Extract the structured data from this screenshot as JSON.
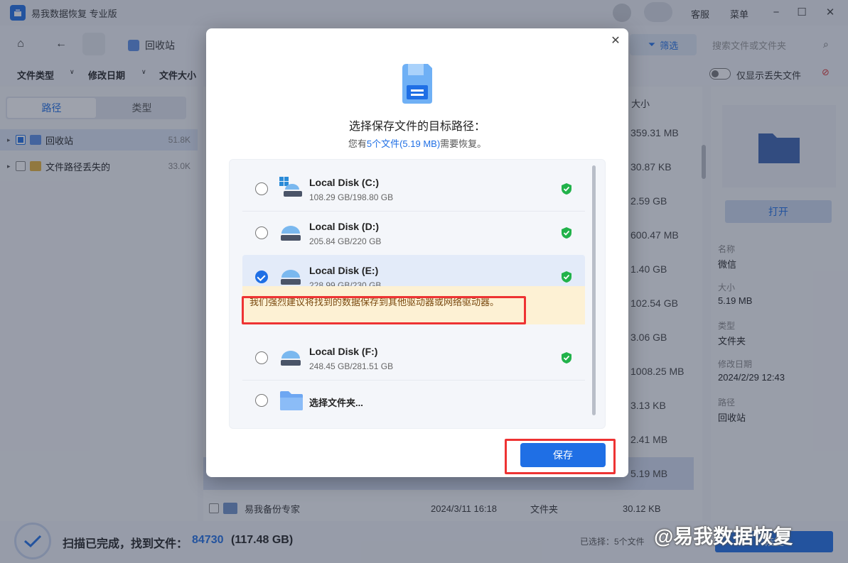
{
  "app": {
    "title": "易我数据恢复 专业版"
  },
  "titlebar": {
    "service": "客服",
    "menu": "菜单"
  },
  "toolbar": {
    "breadcrumb": "回收站",
    "filter_label": "筛选",
    "search_placeholder": "搜索文件或文件夹"
  },
  "filters": {
    "file_type": "文件类型",
    "modified_date": "修改日期",
    "file_size": "文件大小",
    "only_lost": "仅显示丢失文件"
  },
  "sidebar": {
    "tabs": [
      "路径",
      "类型"
    ],
    "items": [
      {
        "label": "回收站",
        "size": "51.8K"
      },
      {
        "label": "文件路径丢失的",
        "size": "33.0K"
      }
    ]
  },
  "list": {
    "size_header": "大小",
    "sizes": [
      "359.31 MB",
      "30.87 KB",
      "2.59 GB",
      "600.47 MB",
      "1.40 GB",
      "102.54 GB",
      "3.06 GB",
      "1008.25 MB",
      "3.13 KB",
      "2.41 MB",
      "5.19 MB",
      "30.12 KB"
    ],
    "last_row": {
      "name": "易我备份专家",
      "date": "2024/3/11 16:18",
      "type": "文件夹",
      "size": "30.12 KB"
    }
  },
  "details": {
    "open_label": "打开",
    "fields": [
      {
        "label": "名称",
        "value": "微信"
      },
      {
        "label": "大小",
        "value": "5.19 MB"
      },
      {
        "label": "类型",
        "value": "文件夹"
      },
      {
        "label": "修改日期",
        "value": "2024/2/29 12:43"
      },
      {
        "label": "路径",
        "value": "回收站"
      }
    ]
  },
  "status": {
    "text": "扫描已完成，找到文件：",
    "count": "84730",
    "size": "(117.48 GB)",
    "selected": "已选择：5个文件",
    "recover_label": "恢复"
  },
  "watermark": "@易我数据恢复",
  "dialog": {
    "title": "选择保存文件的目标路径：",
    "subtitle_prefix": "您有",
    "subtitle_highlight": "5个文件(5.19 MB)",
    "subtitle_suffix": "需要恢复。",
    "disks": [
      {
        "name": "Local Disk (C:)",
        "capacity": "108.29 GB/198.80 GB",
        "selected": false
      },
      {
        "name": "Local Disk (D:)",
        "capacity": "205.84 GB/220 GB",
        "selected": false
      },
      {
        "name": "Local Disk (E:)",
        "capacity": "228.99 GB/230 GB",
        "selected": true
      },
      {
        "name": "Local Disk (F:)",
        "capacity": "248.45 GB/281.51 GB",
        "selected": false
      }
    ],
    "warning": "我们强烈建议将找到的数据保存到其他驱动器或网络驱动器。",
    "choose_folder": "选择文件夹...",
    "save_label": "保存"
  },
  "colors": {
    "accent": "#1f6fe5",
    "warning_bg": "#fdf1d4",
    "highlight_frame": "#e33333",
    "shield_green": "#21b24a"
  }
}
